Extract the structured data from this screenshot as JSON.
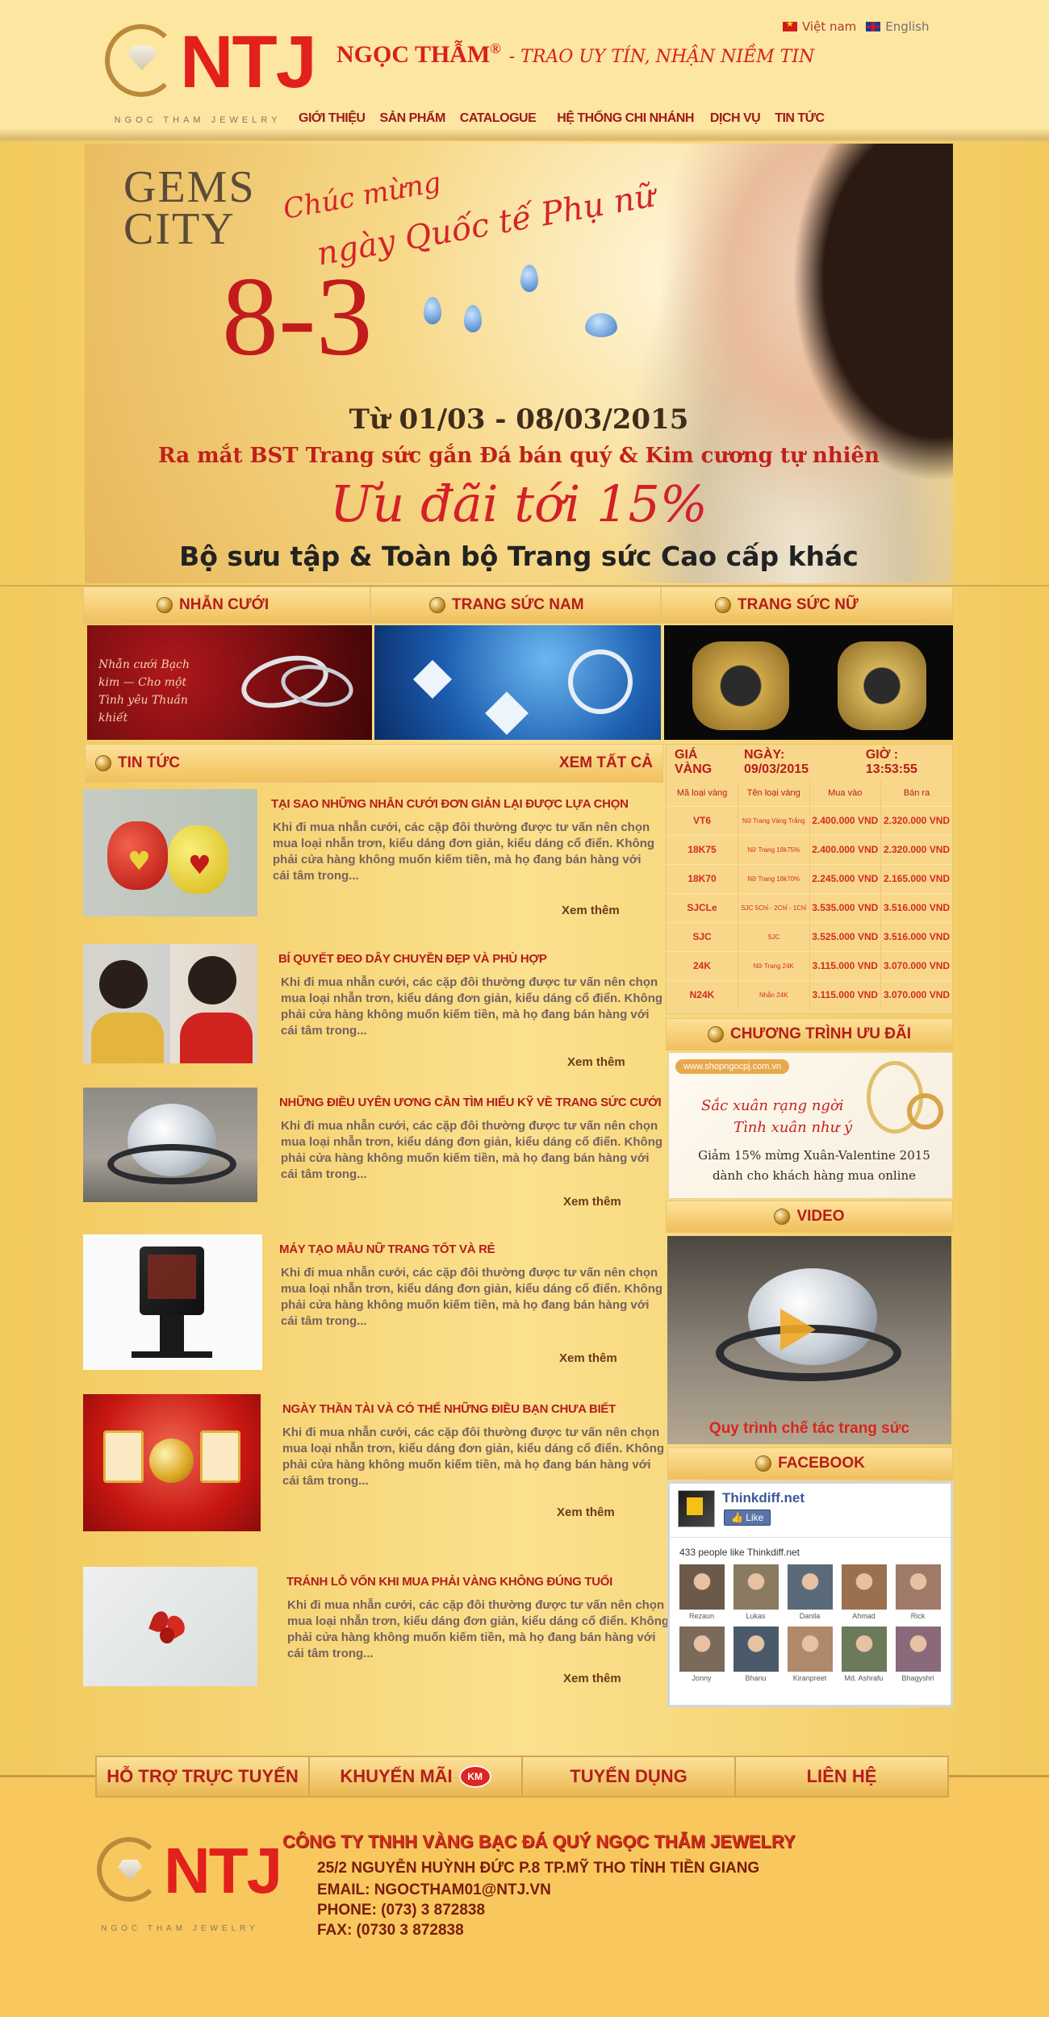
{
  "header": {
    "logo_letters": "NTJ",
    "logo_tagline": "NGOC THAM JEWELRY",
    "brand": "NGỌC THẪM",
    "registered": "®",
    "slogan": "- TRAO UY TÍN, NHẬN NIỀM TIN",
    "languages": [
      "Việt nam",
      "English"
    ],
    "nav": [
      "GIỚI THIỆU",
      "SẢN PHẨM",
      "CATALOGUE",
      "HỆ THỐNG CHI NHÁNH",
      "DỊCH VỤ",
      "TIN TỨC"
    ]
  },
  "banner": {
    "gems_line1": "GEMS",
    "gems_line2": "CITY",
    "greeting1": "Chúc mừng",
    "greeting2": "ngày Quốc tế Phụ nữ",
    "big_number": "8-3",
    "dates": "Từ 01/03 - 08/03/2015",
    "launch": "Ra mắt BST Trang sức gắn Đá bán quý & Kim cương tự nhiên",
    "offer": "Ưu đãi tới 15%",
    "collection": "Bộ sưu tập & Toàn bộ Trang sức Cao cấp khác"
  },
  "categories": [
    {
      "label": "NHẪN CƯỚI",
      "caption": "Nhẫn cưới Bạch kim — Cho một Tình yêu Thuần khiết"
    },
    {
      "label": "TRANG SỨC NAM",
      "caption": ""
    },
    {
      "label": "TRANG SỨC NỮ",
      "caption": ""
    }
  ],
  "news": {
    "heading": "TIN TỨC",
    "see_all": "XEM TẤT CẢ",
    "more_label": "Xem thêm",
    "excerpt": "Khi đi mua nhẫn cưới, các cặp đôi thường được tư vấn nên chọn mua loại nhẫn trơn, kiểu dáng đơn giản, kiểu dáng cổ điển.  Không phải cửa hàng không muốn kiếm tiền, mà họ đang bán hàng với cái  tâm trong...",
    "items": [
      {
        "title": "TẠI SAO NHỮNG NHẪN CƯỚI ĐƠN GIẢN  LẠI ĐƯỢC LỰA CHỌN"
      },
      {
        "title": "BÍ QUYẾT ĐEO DÂY CHUYỀN ĐẸP VÀ PHÙ HỢP"
      },
      {
        "title": "NHỮNG ĐIỀU UYÊN ƯƠNG CẦN TÌM HIỂU  KỸ VỀ TRANG SỨC CƯỚI"
      },
      {
        "title": "MÁY TẠO MẪU NỮ TRANG TỐT VÀ RẺ"
      },
      {
        "title": "NGÀY THẦN TÀI VÀ CÓ THỂ NHỮNG ĐIỀU BẠN CHƯA BIẾT"
      },
      {
        "title": "TRÁNH LỖ VỐN KHI MUA PHẢI VÀNG KHÔNG ĐÚNG TUỔI"
      }
    ]
  },
  "gold_price": {
    "label": "GIÁ VÀNG",
    "date": "NGÀY: 09/03/2015",
    "time": "GIỜ :  13:53:55",
    "columns": [
      "Mã loại vàng",
      "Tên  loại vàng",
      "Mua vào",
      "Bán ra"
    ],
    "rows": [
      [
        "VT6",
        "Nữ Trang Vàng Trắng",
        "2.400.000 VND",
        "2.320.000 VND"
      ],
      [
        "18K75",
        "Nữ Trang 18k75%",
        "2.400.000 VND",
        "2.320.000 VND"
      ],
      [
        "18K70",
        "Nữ Trang 18k70%",
        "2.245.000 VND",
        "2.165.000 VND"
      ],
      [
        "SJCLe",
        "SJC 5Chỉ - 2Chỉ - 1Chỉ",
        "3.535.000 VND",
        "3.516.000 VND"
      ],
      [
        "SJC",
        "SJC",
        "3.525.000 VND",
        "3.516.000 VND"
      ],
      [
        "24K",
        "Nữ Trang 24K",
        "3.115.000 VND",
        "3.070.000 VND"
      ],
      [
        "N24K",
        "Nhẫn 24K",
        "3.115.000 VND",
        "3.070.000 VND"
      ]
    ]
  },
  "promo": {
    "heading": "CHƯƠNG TRÌNH ƯU ĐÃI",
    "site": "www.shopngocpj.com.vn",
    "line1": "Sắc xuân rạng ngời",
    "line2": "Tình xuân như ý",
    "discount": "Giảm 15% mừng Xuân-Valentine 2015",
    "audience": "dành cho khách hàng mua online"
  },
  "video": {
    "heading": "VIDEO",
    "caption": "Quy trình chế tác trang sức"
  },
  "facebook": {
    "heading": "FACEBOOK",
    "page_name": "Thinkdiff.net",
    "like_label": "Like",
    "like_count": "433 people like Thinkdiff.net",
    "people": [
      "Rezaun",
      "Lukas",
      "Danila",
      "Ahmad",
      "Rick",
      "Jonny",
      "Bhanu",
      "Kiranpreet",
      "Md. Ashrafu",
      "Bhagyshri"
    ]
  },
  "footer_nav": [
    "HỖ TRỢ TRỰC TUYẾN",
    "KHUYẾN MÃI",
    "TUYỂN DỤNG",
    "LIÊN HỆ"
  ],
  "footer_nav_badge": "KM",
  "footer": {
    "company": "CÔNG TY TNHH VÀNG BẠC ĐÁ QUÝ NGỌC THẪM JEWELRY",
    "address": "25/2 NGUYỄN HUỲNH ĐỨC P.8  TP.MỸ THO TỈNH TIỀN GIANG",
    "email": "EMAIL: NGOCTHAM01@NTJ.VN",
    "phone": "PHONE: (073) 3 872838",
    "fax": "FAX: (0730 3 872838"
  },
  "colors": {
    "accent_red": "#b61c1c",
    "gold_background": "#f5cf70"
  }
}
